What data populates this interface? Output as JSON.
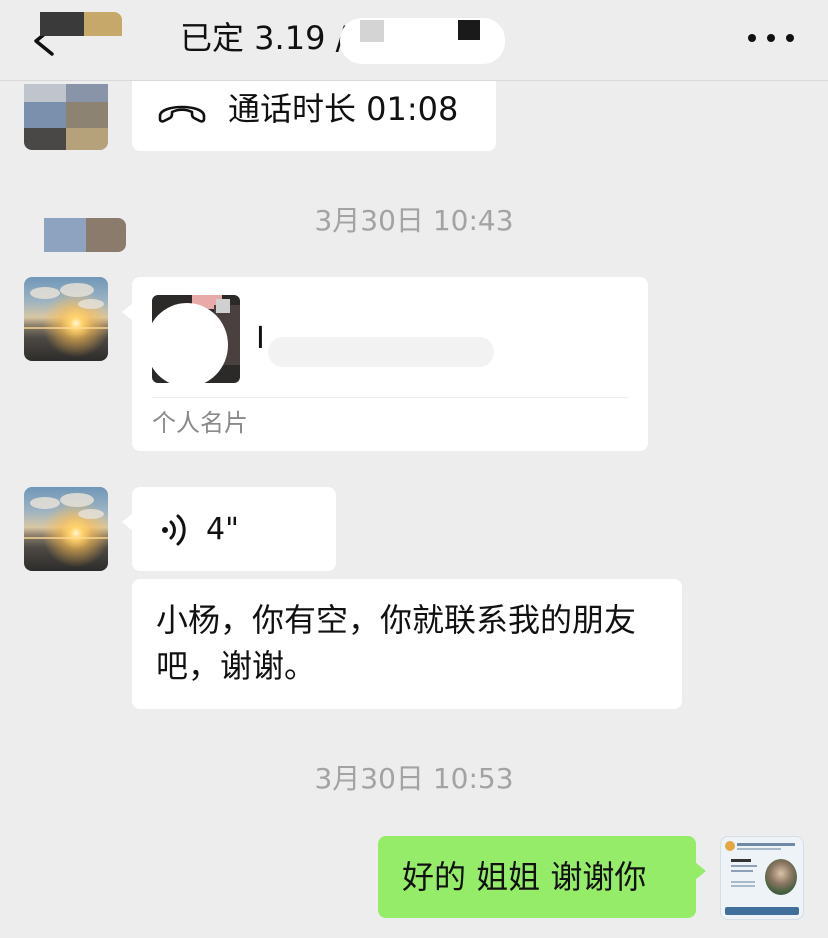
{
  "header": {
    "title": "已定 3.19 /",
    "back_icon": "chevron-left-icon",
    "more_icon": "more-dots-icon"
  },
  "messages": {
    "call": {
      "icon": "phone-icon",
      "text": "通话时长 01:08"
    },
    "timestamp1": "3月30日 10:43",
    "card": {
      "name_initial": "I",
      "footer": "个人名片"
    },
    "voice": {
      "icon": "voice-icon",
      "duration": "4\""
    },
    "text1": "小杨，你有空，你就联系我的朋友吧，谢谢。",
    "timestamp2": "3月30日 10:53",
    "reply": "好的 姐姐 谢谢你"
  },
  "colors": {
    "background": "#ededed",
    "bubble_left": "#ffffff",
    "bubble_right": "#95ec69",
    "timestamp": "#a3a3a3"
  }
}
